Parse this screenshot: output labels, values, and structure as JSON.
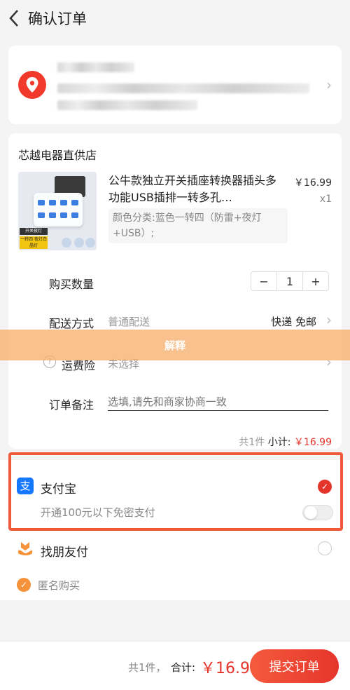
{
  "header": {
    "title": "确认订单"
  },
  "store": {
    "name": "芯越电器直供店",
    "product": {
      "title": "公牛款独立开关插座转换器插头多功能USB插排一转多孔…",
      "price": "￥16.99",
      "quantity": "x1",
      "spec": "颜色分类:蓝色一转四（防雷+夜灯+USB）;",
      "image_tag_1": "开关夜灯",
      "image_tag_2": "一转四 夜灯白晶灯"
    },
    "rows": {
      "qty_label": "购买数量",
      "qty_minus": "−",
      "qty_value": "1",
      "qty_plus": "+",
      "delivery_label": "配送方式",
      "delivery_value": "普通配送",
      "delivery_right": "快递 免邮",
      "insurance_label": "运费险",
      "insurance_value": "未选择",
      "note_label": "订单备注",
      "note_placeholder": "选填,请先和商家协商一致"
    },
    "subtotal": {
      "count": "共1件",
      "label": "小计:",
      "amount": "￥16.99"
    }
  },
  "overlay": {
    "label": "解释"
  },
  "payment": {
    "alipay_label": "支付宝",
    "alipay_sub": "开通100元以下免密支付",
    "friend_label": "找朋友付",
    "anonymous_label": "匿名购买"
  },
  "bottom": {
    "count": "共1件，",
    "total_label": "合计:",
    "total": "￥16.99",
    "submit": "提交订单"
  },
  "colors": {
    "accent": "#e5352b",
    "alipay": "#1677ff",
    "highlight": "#ef5a3a"
  }
}
